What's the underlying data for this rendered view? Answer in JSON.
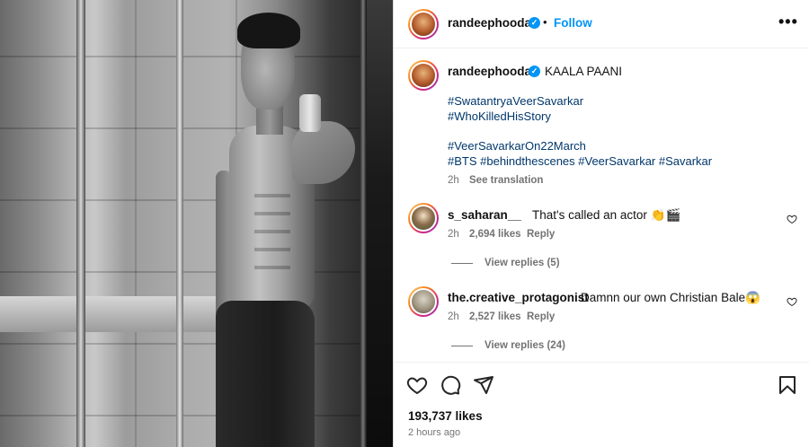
{
  "post": {
    "author": "randeephooda",
    "follow_label": "Follow",
    "separator": "•",
    "more_label": "•••",
    "verified_mark": "✓",
    "caption": "KAALA PAANI",
    "hashtags_line1": "#SwatantryaVeerSavarkar",
    "hashtags_line2": "#WhoKilledHisStory",
    "hashtags_line3": "#VeerSavarkarOn22March",
    "hashtags_line4": "#BTS #behindthescenes #VeerSavarkar #Savarkar",
    "caption_time": "2h",
    "see_translation": "See translation"
  },
  "comments": [
    {
      "user": "s_saharan__",
      "text": "That's called an actor 👏🎬",
      "time": "2h",
      "likes": "2,694 likes",
      "reply": "Reply",
      "view_replies": "View replies (5)"
    },
    {
      "user": "the.creative_protagonist",
      "text": "Damnn our own Christian Bale😱",
      "time": "2h",
      "likes": "2,527 likes",
      "reply": "Reply",
      "view_replies": "View replies (24)"
    }
  ],
  "footer": {
    "likes": "193,737 likes",
    "time": "2 hours ago"
  },
  "icons": {
    "like": "heart-icon",
    "comment": "comment-icon",
    "share": "share-icon",
    "save": "bookmark-icon",
    "more": "more-icon"
  },
  "colors": {
    "accent": "#0095f6",
    "hashtag": "#00376b",
    "muted": "#737373"
  }
}
